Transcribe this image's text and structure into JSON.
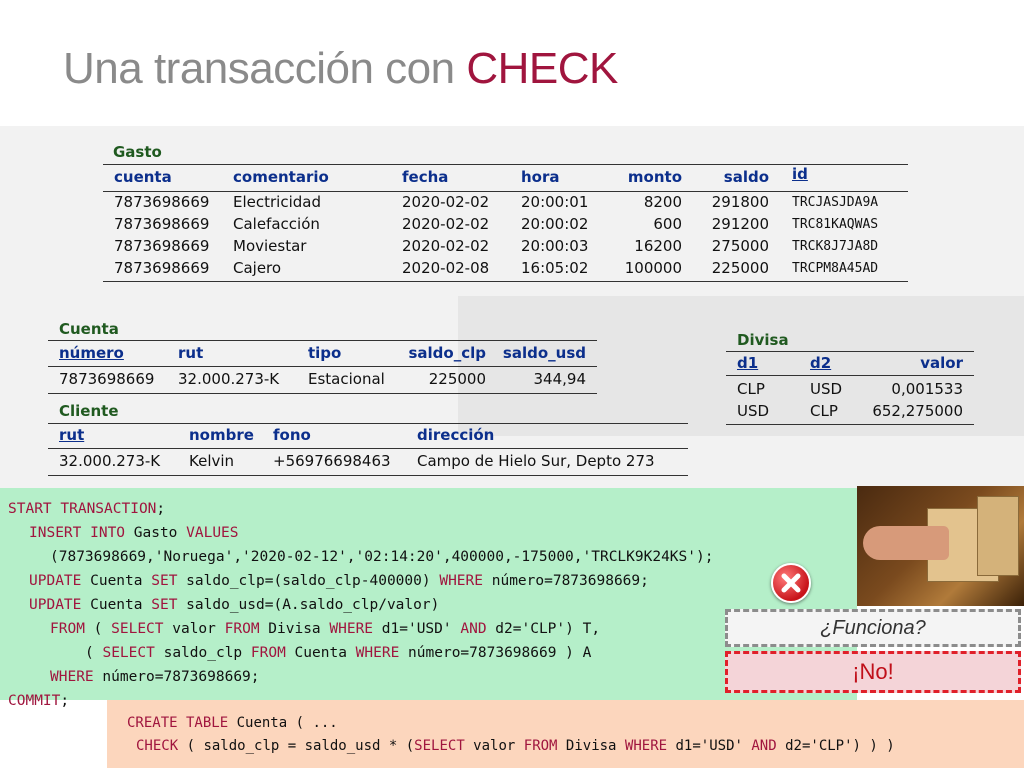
{
  "title": {
    "main": "Una transacción con ",
    "highlight": "CHECK"
  },
  "gasto": {
    "name": "Gasto",
    "headers": [
      "cuenta",
      "comentario",
      "fecha",
      "hora",
      "monto",
      "saldo",
      "id"
    ],
    "rows": [
      [
        "7873698669",
        "Electricidad",
        "2020-02-02",
        "20:00:01",
        "8200",
        "291800",
        "TRCJASJDA9A"
      ],
      [
        "7873698669",
        "Calefacción",
        "2020-02-02",
        "20:00:02",
        "600",
        "291200",
        "TRC81KAQWAS"
      ],
      [
        "7873698669",
        "Moviestar",
        "2020-02-02",
        "20:00:03",
        "16200",
        "275000",
        "TRCK8J7JA8D"
      ],
      [
        "7873698669",
        "Cajero",
        "2020-02-08",
        "16:05:02",
        "100000",
        "225000",
        "TRCPM8A45AD"
      ]
    ]
  },
  "cuenta": {
    "name": "Cuenta",
    "headers": [
      "número",
      "rut",
      "tipo",
      "saldo_clp",
      "saldo_usd"
    ],
    "rows": [
      [
        "7873698669",
        "32.000.273-K",
        "Estacional",
        "225000",
        "344,94"
      ]
    ]
  },
  "cliente": {
    "name": "Cliente",
    "headers": [
      "rut",
      "nombre",
      "fono",
      "dirección"
    ],
    "rows": [
      [
        "32.000.273-K",
        "Kelvin",
        "+56976698463",
        "Campo de Hielo Sur, Depto 273"
      ]
    ]
  },
  "divisa": {
    "name": "Divisa",
    "headers": [
      "d1",
      "d2",
      "valor"
    ],
    "rows": [
      [
        "CLP",
        "USD",
        "0,001533"
      ],
      [
        "USD",
        "CLP",
        "652,275000"
      ]
    ]
  },
  "code": {
    "l1": {
      "k1": "START TRANSACTION",
      "t1": ";"
    },
    "l2": {
      "k1": "INSERT INTO",
      "t1": " Gasto ",
      "k2": "VALUES"
    },
    "l3": {
      "t1": "(7873698669,'Noruega','2020-02-12','02:14:20',400000,-175000,'TRCLK9K24KS');"
    },
    "l4": {
      "k1": "UPDATE",
      "t1": " Cuenta ",
      "k2": "SET",
      "t2": " saldo_clp=(saldo_clp-400000) ",
      "k3": "WHERE",
      "t3": " número=7873698669;"
    },
    "l5": {
      "k1": "UPDATE",
      "t1": " Cuenta ",
      "k2": "SET",
      "t2": " saldo_usd=(A.saldo_clp/valor)"
    },
    "l6": {
      "k1": "FROM",
      "t1": " ( ",
      "k2": "SELECT",
      "t2": " valor ",
      "k3": "FROM",
      "t3": " Divisa ",
      "k4": "WHERE",
      "t4": " d1='USD' ",
      "k5": "AND",
      "t5": " d2='CLP') T,"
    },
    "l7": {
      "t0": "( ",
      "k1": "SELECT",
      "t1": " saldo_clp ",
      "k2": "FROM",
      "t2": " Cuenta ",
      "k3": "WHERE",
      "t3": " número=7873698669 ) A"
    },
    "l8": {
      "k1": "WHERE",
      "t1": " número=7873698669;"
    },
    "l9": {
      "k1": "COMMIT",
      "t1": ";"
    }
  },
  "code2": {
    "l1": {
      "k1": "CREATE TABLE",
      "t1": " Cuenta ( ..."
    },
    "l2": {
      "k1": "CHECK",
      "t1": " ( saldo_clp = saldo_usd * (",
      "k2": "SELECT",
      "t2": " valor ",
      "k3": "FROM",
      "t3": " Divisa ",
      "k4": "WHERE",
      "t4": " d1='USD' ",
      "k5": "AND",
      "t5": " d2='CLP') ) )"
    }
  },
  "question": "¿Funciona?",
  "answer": "¡No!",
  "icons": {
    "error": "x-circle-icon",
    "photo": "hand-on-box-image"
  }
}
